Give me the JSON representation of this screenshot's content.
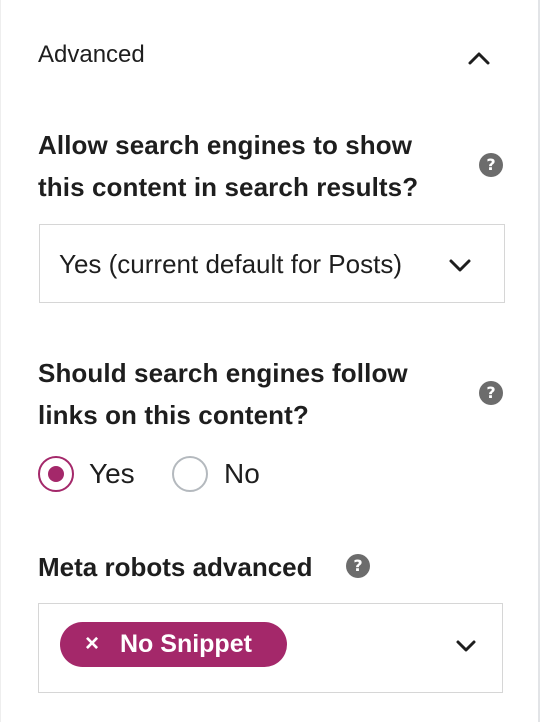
{
  "section": {
    "title": "Advanced",
    "collapse_icon": "chevron-up-icon"
  },
  "search_visibility": {
    "question": "Allow search engines to show this content in search results?",
    "help_icon": "?",
    "selected_value": "Yes (current default for Posts)"
  },
  "follow_links": {
    "question": "Should search engines follow links on this content?",
    "help_icon": "?",
    "options": [
      {
        "label": "Yes",
        "checked": true
      },
      {
        "label": "No",
        "checked": false
      }
    ]
  },
  "meta_robots": {
    "label": "Meta robots advanced",
    "help_icon": "?",
    "selected_tags": [
      {
        "remove": "×",
        "label": "No Snippet"
      }
    ]
  },
  "colors": {
    "accent": "#a4286a",
    "help_icon_bg": "#6c6c6c",
    "border": "#d6d6d6"
  }
}
